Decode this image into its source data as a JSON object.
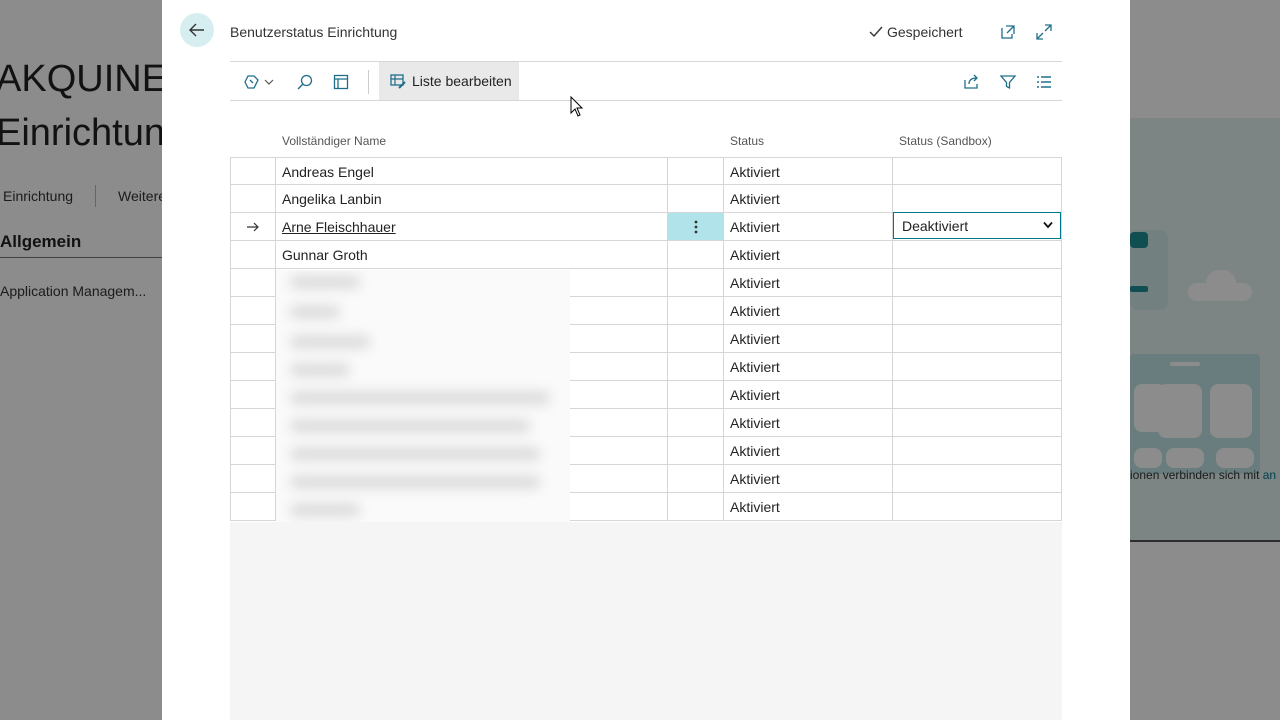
{
  "background": {
    "title_line1": "AKQUINET",
    "title_line2": "Einrichtung",
    "tabs": [
      "Einrichtung",
      "Weitere"
    ],
    "section": "Allgemein",
    "item": "Application Managem...",
    "right_text": "ionen verbinden sich mit",
    "right_link": "an"
  },
  "dialog": {
    "title": "Benutzerstatus Einrichtung",
    "saved_label": "Gespeichert",
    "toolbar": {
      "edit_list_label": "Liste bearbeiten"
    },
    "columns": {
      "name": "Vollständiger Name",
      "status": "Status",
      "sandbox": "Status (Sandbox)"
    },
    "rows": [
      {
        "name": "Andreas Engel",
        "status": "Aktiviert",
        "sandbox": ""
      },
      {
        "name": "Angelika Lanbin",
        "status": "Aktiviert",
        "sandbox": ""
      },
      {
        "name": "Arne Fleischhauer",
        "status": "Aktiviert",
        "sandbox": "Deaktiviert",
        "active": true
      },
      {
        "name": "Gunnar Groth",
        "status": "Aktiviert",
        "sandbox": ""
      },
      {
        "name": "",
        "status": "Aktiviert",
        "sandbox": ""
      },
      {
        "name": "",
        "status": "Aktiviert",
        "sandbox": ""
      },
      {
        "name": "",
        "status": "Aktiviert",
        "sandbox": ""
      },
      {
        "name": "",
        "status": "Aktiviert",
        "sandbox": ""
      },
      {
        "name": "",
        "status": "Aktiviert",
        "sandbox": ""
      },
      {
        "name": "",
        "status": "Aktiviert",
        "sandbox": ""
      },
      {
        "name": "",
        "status": "Aktiviert",
        "sandbox": ""
      },
      {
        "name": "",
        "status": "Aktiviert",
        "sandbox": ""
      },
      {
        "name": "",
        "status": "Aktiviert",
        "sandbox": ""
      }
    ],
    "sandbox_options": [
      "Deaktiviert"
    ]
  },
  "colors": {
    "accent": "#00788a",
    "active_cell": "#b0e4ea",
    "back_button": "#d6eef0"
  }
}
